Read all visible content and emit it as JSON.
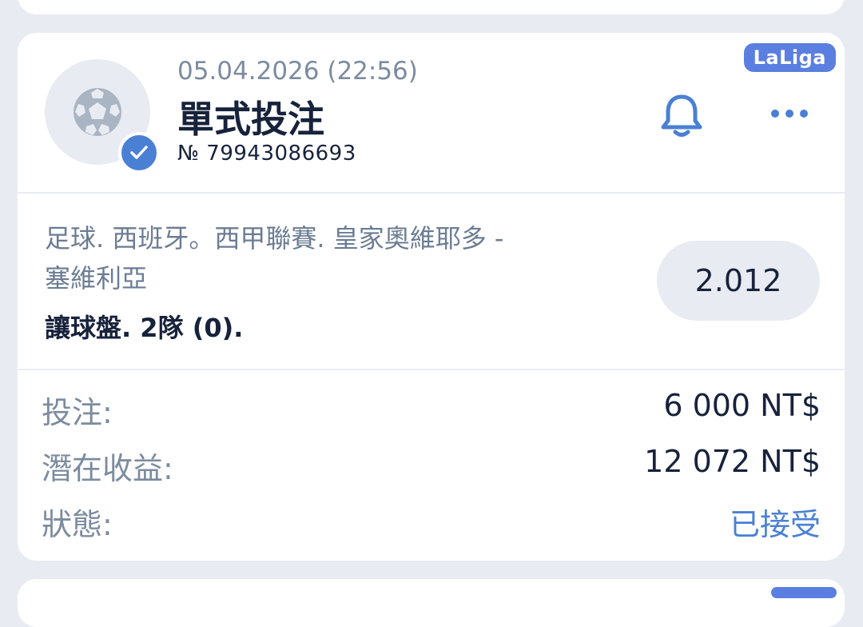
{
  "bet": {
    "league_badge": "LaLiga",
    "date": "05.04.2026 (22:56)",
    "title": "單式投注",
    "number": "№ 79943086693",
    "sport_icon": "soccer-ball-icon",
    "status_icon": "check-icon",
    "notify_icon": "bell-icon",
    "menu_icon": "more-icon",
    "event_line1": "足球. 西班牙。西甲聯賽. 皇家奧維耶多 -",
    "event_line2": "塞維利亞",
    "market": "讓球盤. 2隊 (0).",
    "odds": "2.012",
    "stake_label": "投注:",
    "stake_value": "6 000 NT$",
    "payout_label": "潛在收益:",
    "payout_value": "12 072 NT$",
    "status_label": "狀態:",
    "status_value": "已接受"
  },
  "colors": {
    "page_background": "#e8ecf2",
    "card_background": "#ffffff",
    "accent_blue": "#4a80d4",
    "badge_blue": "#5b7fe0",
    "primary_text": "#17223b",
    "secondary_text": "#7c8b9f"
  }
}
